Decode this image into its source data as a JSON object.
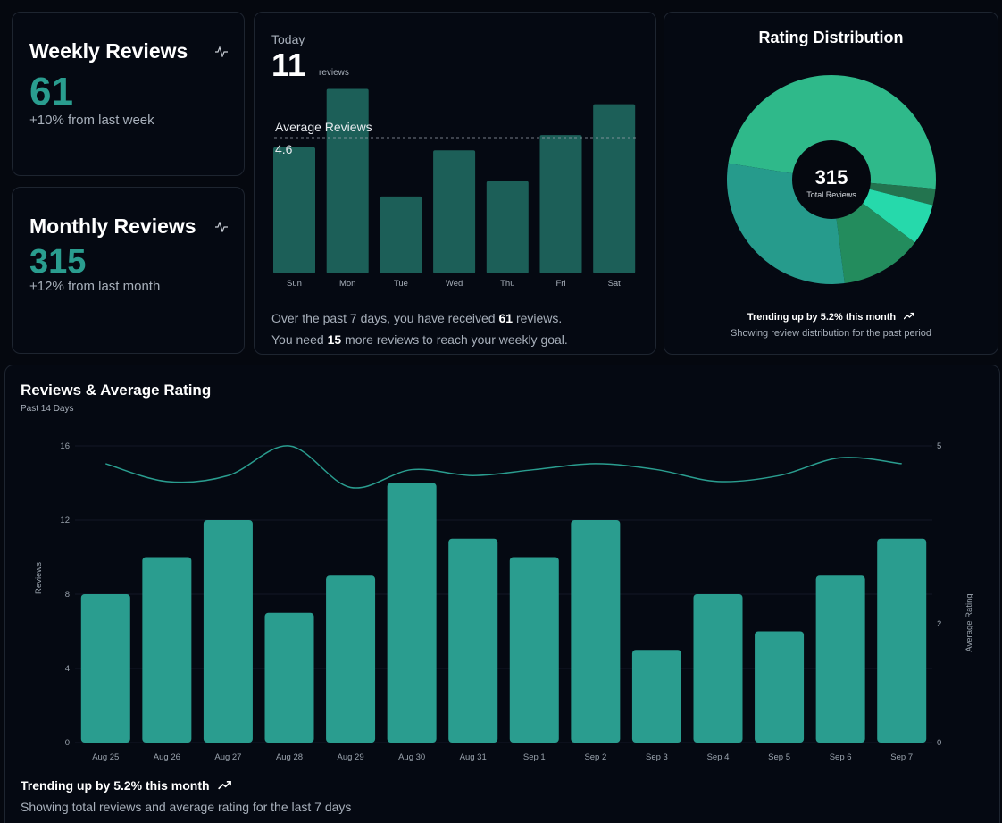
{
  "weekly": {
    "title": "Weekly Reviews",
    "value": "61",
    "change": "+10% from last week",
    "icon": "activity-icon"
  },
  "monthly": {
    "title": "Monthly Reviews",
    "value": "315",
    "change": "+12% from last month",
    "icon": "activity-icon"
  },
  "today": {
    "label": "Today",
    "value": "11",
    "unit": "reviews",
    "avg_label": "Average Reviews",
    "avg_value": "4.6",
    "days": [
      "Sun",
      "Mon",
      "Tue",
      "Wed",
      "Thu",
      "Fri",
      "Sat"
    ],
    "counts": [
      8.2,
      12,
      5,
      8,
      6,
      9,
      11
    ],
    "ymax": 12.2,
    "summary": {
      "line1_pre": "Over the past 7 days, you have received ",
      "line1_bold": "61",
      "line1_post": " reviews.",
      "line2_pre": "You need ",
      "line2_bold": "15",
      "line2_post": " more reviews to reach your weekly goal."
    }
  },
  "distribution": {
    "title": "Rating Distribution",
    "total": "315",
    "total_label": "Total Reviews",
    "trend": "Trending up by 5.2% this month",
    "caption": "Showing review distribution for the past period",
    "slices": [
      {
        "value": 154,
        "color": "#2fb98a"
      },
      {
        "value": 8,
        "color": "#23744f"
      },
      {
        "value": 20,
        "color": "#26d9ab"
      },
      {
        "value": 40,
        "color": "#238c5d"
      },
      {
        "value": 93,
        "color": "#269b8c"
      }
    ]
  },
  "colors": {
    "accent": "#2a9d8f",
    "bar_dark": "#1c5f58",
    "line": "#2a9d8f"
  },
  "main_chart": {
    "title": "Reviews & Average Rating",
    "subtitle": "Past 14 Days",
    "trend": "Trending up by 5.2% this month",
    "caption": "Showing total reviews and average rating for the last 7 days",
    "left_axis_label": "Reviews",
    "right_axis_label": "Average Rating"
  },
  "chart_data": {
    "type": "bar",
    "categories": [
      "Aug 25",
      "Aug 26",
      "Aug 27",
      "Aug 28",
      "Aug 29",
      "Aug 30",
      "Aug 31",
      "Sep 1",
      "Sep 2",
      "Sep 3",
      "Sep 4",
      "Sep 5",
      "Sep 6",
      "Sep 7"
    ],
    "series": [
      {
        "name": "Reviews",
        "type": "bar",
        "axis": "left",
        "values": [
          8,
          10,
          12,
          7,
          9,
          14,
          11,
          10,
          12,
          5,
          8,
          6,
          9,
          11
        ]
      },
      {
        "name": "Average Rating",
        "type": "line",
        "axis": "right",
        "values": [
          4.7,
          4.4,
          4.5,
          5.0,
          4.3,
          4.6,
          4.5,
          4.6,
          4.7,
          4.6,
          4.4,
          4.5,
          4.8,
          4.7
        ]
      }
    ],
    "ylim_left": [
      0,
      16
    ],
    "yticks_left": [
      0,
      4,
      8,
      12,
      16
    ],
    "ylim_right": [
      0,
      5
    ],
    "yticks_right": [
      0,
      2,
      5
    ],
    "ylabel_left": "Reviews",
    "ylabel_right": "Average Rating",
    "grid": true
  }
}
